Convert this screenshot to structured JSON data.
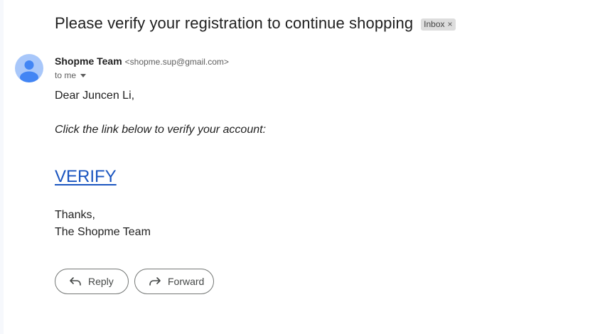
{
  "email": {
    "subject": "Please verify your registration to continue shopping",
    "label": "Inbox",
    "label_remove": "×",
    "sender": {
      "name": "Shopme Team",
      "email": "<shopme.sup@gmail.com>"
    },
    "recipient": "to me",
    "body": {
      "greeting": "Dear Juncen Li,",
      "instruction": "Click the link below to verify your account:",
      "link_text": "VERIFY",
      "closing": "Thanks,",
      "signature": "The Shopme Team"
    }
  },
  "actions": {
    "reply_label": "Reply",
    "forward_label": "Forward"
  },
  "colors": {
    "link": "#1a55c0",
    "avatar_bg": "#a8c7fa",
    "avatar_fg": "#4285f4",
    "chip_bg": "#dddddd"
  },
  "icons": {
    "avatar": "person-icon",
    "reply": "reply-arrow-icon",
    "forward": "forward-arrow-icon",
    "recipient_details": "caret-down-icon",
    "remove_label": "close-icon"
  }
}
